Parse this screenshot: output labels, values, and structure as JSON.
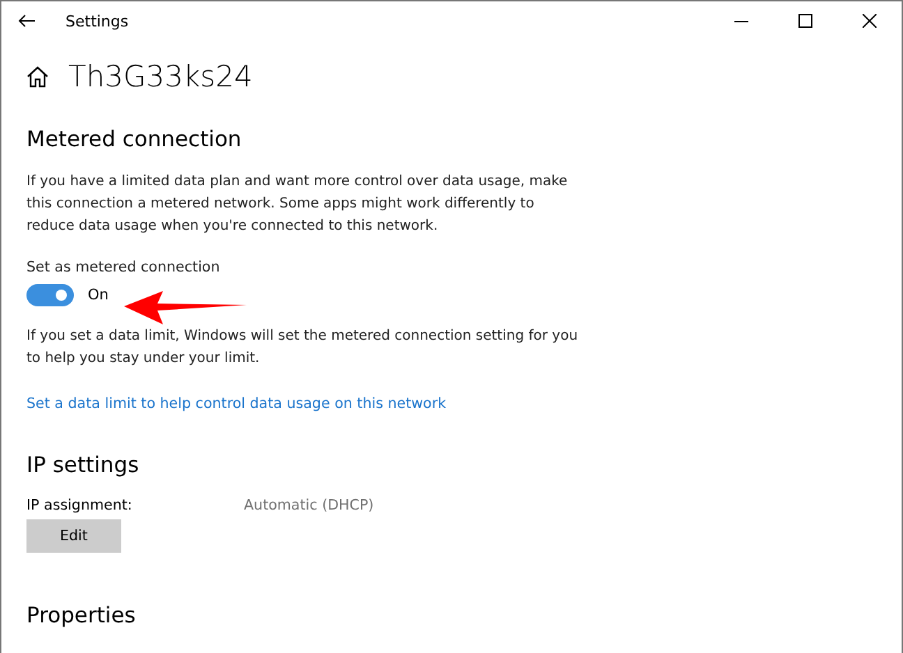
{
  "window": {
    "title": "Settings"
  },
  "page_title": "Th3G33ks24",
  "metered": {
    "heading": "Metered connection",
    "description": "If you have a limited data plan and want more control over data usage, make this connection a metered network. Some apps might work differently to reduce data usage when you're connected to this network.",
    "toggle": {
      "label": "Set as metered connection",
      "on": true,
      "state_text": "On"
    },
    "note": "If you set a data limit, Windows will set the metered connection setting for you to help you stay under your limit.",
    "link": "Set a data limit to help control data usage on this network"
  },
  "ip_settings": {
    "heading": "IP settings",
    "label": "IP assignment:",
    "value": "Automatic (DHCP)",
    "button": "Edit"
  },
  "properties": {
    "heading": "Properties"
  }
}
